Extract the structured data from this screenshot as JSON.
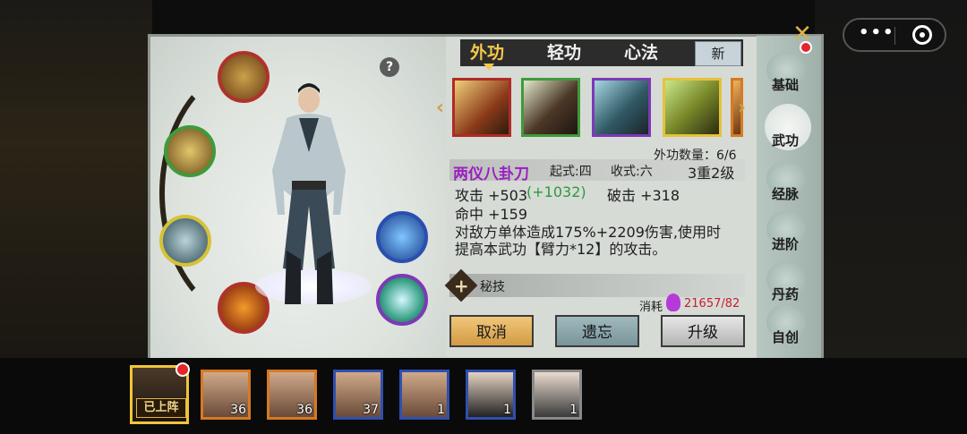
{
  "tabs": {
    "active": "外功",
    "items": [
      "外功",
      "轻功",
      "心法"
    ],
    "new_label": "新"
  },
  "help_label": "?",
  "skill_count_label": "外功数量：6/6",
  "skill": {
    "name": "两仪八卦刀",
    "start_stance": "起式:四",
    "end_stance": "收式:六",
    "level": "3重2级",
    "attack": "攻击 +503",
    "attack_bonus": "(+1032)",
    "critical": "破击 +318",
    "accuracy": "命中 +159",
    "desc_line1": "对敌方单体造成175%+2209伤害,使用时",
    "desc_line2": "提高本武功【臂力*12】的攻击。"
  },
  "secret_label": "秘技",
  "cost": {
    "label": "消耗",
    "value": "21657/82"
  },
  "buttons": {
    "cancel": "取消",
    "note": "遗忘",
    "upgrade": "升级"
  },
  "sidebar": [
    {
      "label": "基础",
      "active": false
    },
    {
      "label": "武功",
      "active": true
    },
    {
      "label": "经脉",
      "active": false
    },
    {
      "label": "进阶",
      "active": false
    },
    {
      "label": "丹药",
      "active": false
    },
    {
      "label": "自创",
      "active": false
    }
  ],
  "roster": {
    "onstage_label": "已上阵",
    "levels": [
      "36",
      "36",
      "37",
      "1",
      "1",
      "1"
    ]
  },
  "colors": {
    "skill_name": "#9a20c0",
    "bonus": "#2c9a3a",
    "cost_value": "#c8202c"
  }
}
